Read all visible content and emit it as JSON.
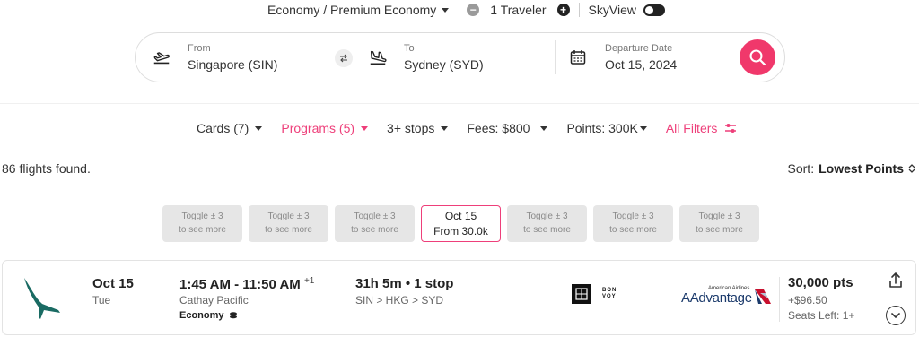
{
  "topbar": {
    "cabin_label": "Economy / Premium Economy",
    "travelers_label": "1 Traveler",
    "skyview_label": "SkyView"
  },
  "search": {
    "from_label": "From",
    "from_value": "Singapore (SIN)",
    "to_label": "To",
    "to_value": "Sydney (SYD)",
    "date_label": "Departure Date",
    "date_value": "Oct 15, 2024"
  },
  "filters": {
    "items": [
      {
        "label": "Cards (7)",
        "active": false
      },
      {
        "label": "Programs (5)",
        "active": true
      },
      {
        "label": "3+ stops",
        "active": false
      },
      {
        "label": "Fees: $800",
        "active": false
      },
      {
        "label": "Points: 300K",
        "active": false
      }
    ],
    "all_filters_label": "All Filters"
  },
  "results": {
    "count_text": "86 flights found.",
    "sort_label": "Sort:",
    "sort_value": "Lowest Points"
  },
  "date_cards": [
    {
      "line1": "Toggle ± 3",
      "line2": "to see more",
      "active": false
    },
    {
      "line1": "Toggle ± 3",
      "line2": "to see more",
      "active": false
    },
    {
      "line1": "Toggle ± 3",
      "line2": "to see more",
      "active": false
    },
    {
      "line1": "Oct 15",
      "line2": "From 30.0k",
      "active": true
    },
    {
      "line1": "Toggle ± 3",
      "line2": "to see more",
      "active": false
    },
    {
      "line1": "Toggle ± 3",
      "line2": "to see more",
      "active": false
    },
    {
      "line1": "Toggle ± 3",
      "line2": "to see more",
      "active": false
    }
  ],
  "flight": {
    "date": "Oct 15",
    "day": "Tue",
    "times": "1:45 AM - 11:50 AM",
    "day_offset": "+1",
    "airline": "Cathay Pacific",
    "cabin": "Economy",
    "duration": "31h 5m • 1 stop",
    "route": "SIN > HKG > SYD",
    "bonvoy_text": "BON VOY",
    "program_small": "American Airlines",
    "program_name": "AAdvantage",
    "points": "30,000 pts",
    "fees": "+$96.50",
    "seats": "Seats Left: 1+"
  },
  "colors": {
    "accent": "#f0386b",
    "cathay_green": "#1a6b63",
    "aa_navy": "#1b3a6b"
  }
}
